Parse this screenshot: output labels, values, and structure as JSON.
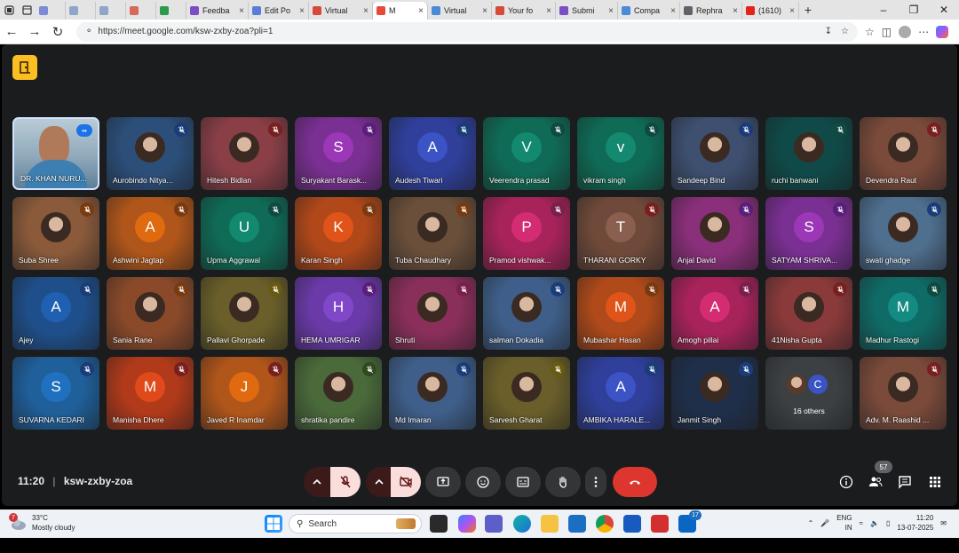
{
  "browser": {
    "tabs": [
      {
        "label": "",
        "color": "#7b8bd6"
      },
      {
        "label": "",
        "color": "#8ea6c7"
      },
      {
        "label": "",
        "color": "#8ea6c7"
      },
      {
        "label": "",
        "color": "#d66a5a"
      },
      {
        "label": "",
        "color": "#2b9a4a"
      },
      {
        "label": "Feedba",
        "color": "#7b4ec4"
      },
      {
        "label": "Edit Po",
        "color": "#5b7dd6"
      },
      {
        "label": "Virtual",
        "color": "#d64a3a"
      },
      {
        "label": "M",
        "color": "#e64a3a"
      },
      {
        "label": "Virtual",
        "color": "#4b8ad6"
      },
      {
        "label": "Your fo",
        "color": "#d64a3a"
      },
      {
        "label": "Submi",
        "color": "#7b4ec4"
      },
      {
        "label": "Compa",
        "color": "#4b8ad6"
      },
      {
        "label": "Rephra",
        "color": "#5f6368"
      },
      {
        "label": "(1610)",
        "color": "#e62117"
      }
    ],
    "url": "https://meet.google.com/ksw-zxby-zoa?pli=1"
  },
  "meet": {
    "time": "11:20",
    "code": "ksw-zxby-zoa",
    "participants_count": "57",
    "participants": [
      {
        "name": "DR. KHAN NURU...",
        "initial": "",
        "type": "self",
        "bg": "#6f8fa6"
      },
      {
        "name": "Aurobindo Nitya...",
        "initial": "",
        "type": "photo",
        "bg": "#2c4f7a",
        "mic": "blue"
      },
      {
        "name": "Hitesh Bidlan",
        "initial": "",
        "type": "photo",
        "bg": "#8a3f47",
        "mic": "red"
      },
      {
        "name": "Suryakant Barask...",
        "initial": "S",
        "type": "letter",
        "bg": "#7a2f92",
        "av": "#9c38b8",
        "mic": "purple"
      },
      {
        "name": "Audesh Tiwari",
        "initial": "A",
        "type": "letter",
        "bg": "#2f3f9a",
        "av": "#3b53c4",
        "mic": "blue"
      },
      {
        "name": "Veerendra prasad",
        "initial": "V",
        "type": "letter",
        "bg": "#0f6b56",
        "av": "#138a6f",
        "mic": "teal"
      },
      {
        "name": "vikram singh",
        "initial": "v",
        "type": "letter",
        "bg": "#0f6b56",
        "av": "#138a6f",
        "mic": "teal"
      },
      {
        "name": "Sandeep Bind",
        "initial": "",
        "type": "photo",
        "bg": "#3e4f70",
        "mic": "blue"
      },
      {
        "name": "ruchi banwani",
        "initial": "",
        "type": "photo",
        "bg": "#0f4a48",
        "mic": "teal"
      },
      {
        "name": "Devendra Raut",
        "initial": "",
        "type": "photo",
        "bg": "#7a4a3a",
        "mic": "red"
      },
      {
        "name": "Suba Shree",
        "initial": "",
        "type": "photo",
        "bg": "#8a5a3a",
        "mic": "orange"
      },
      {
        "name": "Ashwini Jagtap",
        "initial": "A",
        "type": "letter",
        "bg": "#b0561a",
        "av": "#e06a10",
        "mic": "orange"
      },
      {
        "name": "Upma Aggrawal",
        "initial": "U",
        "type": "letter",
        "bg": "#0f6b56",
        "av": "#138a6f",
        "mic": "teal"
      },
      {
        "name": "Karan Singh",
        "initial": "K",
        "type": "letter",
        "bg": "#b0481a",
        "av": "#e0541a",
        "mic": "orange"
      },
      {
        "name": "Tuba Chaudhary",
        "initial": "",
        "type": "photo",
        "bg": "#6a4f3a",
        "mic": "orange"
      },
      {
        "name": "Pramod vishwak...",
        "initial": "P",
        "type": "letter",
        "bg": "#a8235a",
        "av": "#d42c72",
        "mic": "pink"
      },
      {
        "name": "THARANI GORKY",
        "initial": "T",
        "type": "letter",
        "bg": "#6f4a3a",
        "av": "#8a5f4f",
        "mic": "red"
      },
      {
        "name": "Anjal David",
        "initial": "",
        "type": "photo",
        "bg": "#8a2f7a",
        "mic": "purple"
      },
      {
        "name": "SATYAM SHRIVA...",
        "initial": "S",
        "type": "letter",
        "bg": "#7a2f92",
        "av": "#9c38b8",
        "mic": "purple"
      },
      {
        "name": "swati ghadge",
        "initial": "",
        "type": "photo",
        "bg": "#4f6f8f",
        "mic": "blue"
      },
      {
        "name": "Ajey",
        "initial": "A",
        "type": "letter",
        "bg": "#1f4f8a",
        "av": "#2060b0",
        "mic": "blue"
      },
      {
        "name": "Sania Rane",
        "initial": "",
        "type": "photo",
        "bg": "#8a4a2a",
        "mic": "orange"
      },
      {
        "name": "Pallavi Ghorpade",
        "initial": "",
        "type": "photo",
        "bg": "#6a5f2a",
        "mic": "yellow"
      },
      {
        "name": "HEMA UMRIGAR",
        "initial": "H",
        "type": "letter",
        "bg": "#6a3aa8",
        "av": "#8048c8",
        "mic": "purple"
      },
      {
        "name": "Shruti",
        "initial": "",
        "type": "photo",
        "bg": "#8a2f5a",
        "mic": "pink"
      },
      {
        "name": "salman Dokadia",
        "initial": "",
        "type": "photo",
        "bg": "#3f5f8a",
        "mic": "blue"
      },
      {
        "name": "Mubashar Hasan",
        "initial": "M",
        "type": "letter",
        "bg": "#b04a1a",
        "av": "#e0541a",
        "mic": "orange"
      },
      {
        "name": "Amogh pillai",
        "initial": "A",
        "type": "letter",
        "bg": "#a8235a",
        "av": "#d42c72",
        "mic": "pink"
      },
      {
        "name": "41Nisha Gupta",
        "initial": "",
        "type": "photo",
        "bg": "#8a3a3a",
        "mic": "red"
      },
      {
        "name": "Madhur Rastogi",
        "initial": "M",
        "type": "letter",
        "bg": "#0f6b66",
        "av": "#138a82",
        "mic": "teal"
      },
      {
        "name": "SUVARNA KEDARI",
        "initial": "S",
        "type": "letter",
        "bg": "#1f5f9a",
        "av": "#2070c0",
        "mic": "blue"
      },
      {
        "name": "Manisha Dhere",
        "initial": "M",
        "type": "letter",
        "bg": "#b03a1a",
        "av": "#e04a1a",
        "mic": "red"
      },
      {
        "name": "Javed R Inamdar",
        "initial": "J",
        "type": "letter",
        "bg": "#b0561a",
        "av": "#e06a10",
        "mic": "red"
      },
      {
        "name": "shratika pandire",
        "initial": "",
        "type": "photo",
        "bg": "#4a6a3a",
        "mic": "green"
      },
      {
        "name": "Md Imaran",
        "initial": "",
        "type": "photo",
        "bg": "#3f5f8a",
        "mic": "blue"
      },
      {
        "name": "Sarvesh Gharat",
        "initial": "",
        "type": "photo",
        "bg": "#6a5f2a",
        "mic": "yellow"
      },
      {
        "name": "AMBIKA HARALE...",
        "initial": "A",
        "type": "letter",
        "bg": "#2f3f9a",
        "av": "#3b53c4",
        "mic": "blue"
      },
      {
        "name": "Janmit Singh",
        "initial": "",
        "type": "photo",
        "bg": "#1f2f4a",
        "mic": "blue"
      },
      {
        "name": "16 others",
        "initial": "C",
        "type": "others",
        "bg": "#3c4043",
        "av": "#3b53c4"
      },
      {
        "name": "Adv. M. Raashid ...",
        "initial": "",
        "type": "photo",
        "bg": "#7a4a3a",
        "mic": "red"
      }
    ]
  },
  "taskbar": {
    "weather_temp": "33°C",
    "weather_desc": "Mostly cloudy",
    "weather_badge": "7",
    "search_placeholder": "Search",
    "lang_1": "ENG",
    "lang_2": "IN",
    "clock_time": "11:20",
    "clock_date": "13-07-2025",
    "store_badge": "17"
  }
}
